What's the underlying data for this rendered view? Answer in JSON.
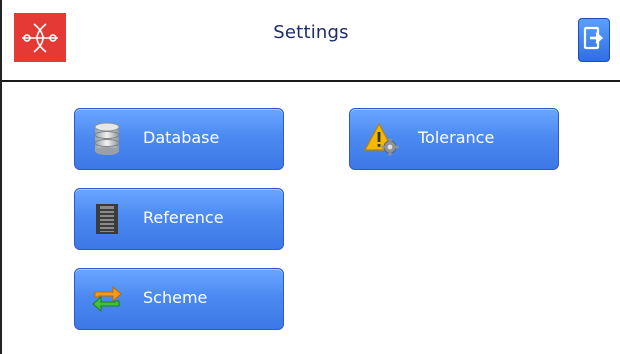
{
  "header": {
    "title": "Settings"
  },
  "icons": {
    "logo": "brand-logo-icon",
    "exit": "exit-icon"
  },
  "colors": {
    "logo_bg": "#e53935",
    "button_blue": "#4c8af2",
    "title_text": "#1f2a6b"
  },
  "buttons": [
    {
      "label": "Database",
      "icon": "database-icon"
    },
    {
      "label": "Reference",
      "icon": "film-strip-icon"
    },
    {
      "label": "Scheme",
      "icon": "sync-arrows-icon"
    },
    {
      "label": "Tolerance",
      "icon": "warning-gear-icon"
    }
  ]
}
